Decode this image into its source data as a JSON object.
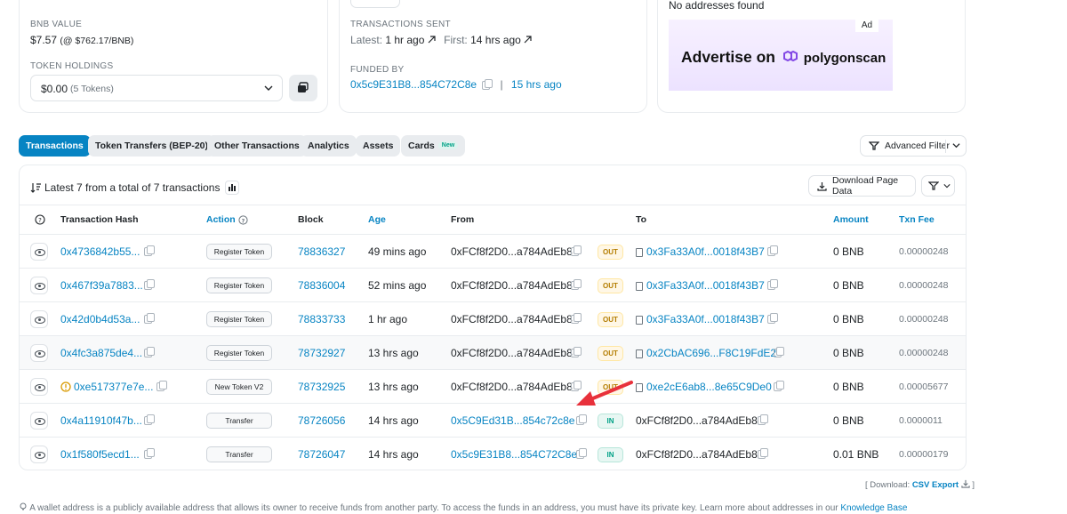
{
  "overview": {
    "bnb_value_label": "BNB VALUE",
    "bnb_value": "$7.57",
    "bnb_price": "(@ $762.17/BNB)",
    "token_holdings_label": "TOKEN HOLDINGS",
    "token_holdings_value": "$0.00",
    "token_holdings_count": "(5 Tokens)"
  },
  "more_info": {
    "tx_sent_label": "TRANSACTIONS SENT",
    "latest_label": "Latest:",
    "latest_value": "1 hr ago",
    "first_label": "First:",
    "first_value": "14 hrs ago",
    "funded_by_label": "FUNDED BY",
    "funded_by_address": "0x5c9E31B8...854C72C8e",
    "funded_by_sep": "|",
    "funded_by_time": "15 hrs ago"
  },
  "ad_panel": {
    "no_addresses": "No addresses found",
    "ad_badge": "Ad",
    "ad_text": "Advertise on",
    "ad_brand": "polygonscan"
  },
  "tabs": [
    {
      "label": "Transactions"
    },
    {
      "label": "Token Transfers (BEP-20)"
    },
    {
      "label": "Other Transactions"
    },
    {
      "label": "Analytics"
    },
    {
      "label": "Assets"
    },
    {
      "label": "Cards",
      "badge": "New"
    }
  ],
  "advanced_filter_label": "Advanced Filter",
  "table": {
    "summary": "Latest 7 from a total of 7 transactions",
    "download_label": "Download Page Data",
    "headers": {
      "hash": "Transaction Hash",
      "action": "Action",
      "block": "Block",
      "age": "Age",
      "from": "From",
      "to": "To",
      "amount": "Amount",
      "fee": "Txn Fee"
    },
    "rows": [
      {
        "hash": "0x4736842b55...",
        "warn": false,
        "method": "Register Token",
        "block": "78836327",
        "age": "49 mins ago",
        "from": "0xFCf8f2D0...a784AdEb8",
        "from_link": false,
        "dir": "OUT",
        "to": "0x3Fa33A0f...0018f43B7",
        "to_contract": true,
        "amount": "0 BNB",
        "fee": "0.00000248"
      },
      {
        "hash": "0x467f39a7883...",
        "warn": false,
        "method": "Register Token",
        "block": "78836004",
        "age": "52 mins ago",
        "from": "0xFCf8f2D0...a784AdEb8",
        "from_link": false,
        "dir": "OUT",
        "to": "0x3Fa33A0f...0018f43B7",
        "to_contract": true,
        "amount": "0 BNB",
        "fee": "0.00000248"
      },
      {
        "hash": "0x42d0b4d53a...",
        "warn": false,
        "method": "Register Token",
        "block": "78833733",
        "age": "1 hr ago",
        "from": "0xFCf8f2D0...a784AdEb8",
        "from_link": false,
        "dir": "OUT",
        "to": "0x3Fa33A0f...0018f43B7",
        "to_contract": true,
        "amount": "0 BNB",
        "fee": "0.00000248"
      },
      {
        "hash": "0x4fc3a875de4...",
        "warn": false,
        "method": "Register Token",
        "block": "78732927",
        "age": "13 hrs ago",
        "from": "0xFCf8f2D0...a784AdEb8",
        "from_link": false,
        "dir": "OUT",
        "to": "0x2CbAC696...F8C19FdE2",
        "to_contract": true,
        "amount": "0 BNB",
        "fee": "0.00000248"
      },
      {
        "hash": "0xe517377e7e...",
        "warn": true,
        "method": "New Token V2",
        "block": "78732925",
        "age": "13 hrs ago",
        "from": "0xFCf8f2D0...a784AdEb8",
        "from_link": false,
        "dir": "OUT",
        "to": "0xe2cE6ab8...8e65C9De0",
        "to_contract": true,
        "amount": "0 BNB",
        "fee": "0.00005677"
      },
      {
        "hash": "0x4a11910f47b...",
        "warn": false,
        "method": "Transfer",
        "block": "78726056",
        "age": "14 hrs ago",
        "from": "0x5C9Ed31B...854c72c8e",
        "from_link": true,
        "dir": "IN",
        "to": "0xFCf8f2D0...a784AdEb8",
        "to_contract": false,
        "amount": "0 BNB",
        "fee": "0.0000011"
      },
      {
        "hash": "0x1f580f5ecd1...",
        "warn": false,
        "method": "Transfer",
        "block": "78726047",
        "age": "14 hrs ago",
        "from": "0x5c9E31B8...854C72C8e",
        "from_link": true,
        "dir": "IN",
        "to": "0xFCf8f2D0...a784AdEb8",
        "to_contract": false,
        "amount": "0.01 BNB",
        "fee": "0.00000179"
      }
    ]
  },
  "footer": {
    "download_prefix": "[ Download:",
    "csv_label": "CSV Export",
    "download_suffix": "]",
    "note": "A wallet address is a publicly available address that allows its owner to receive funds from another party. To access the funds in an address, you must have its private key. Learn more about addresses in our",
    "kb_link": "Knowledge Base"
  },
  "colors": {
    "accent": "#0784c3",
    "out": "#b47d00",
    "in": "#00a186",
    "annotation_arrow": "#e8313b"
  }
}
